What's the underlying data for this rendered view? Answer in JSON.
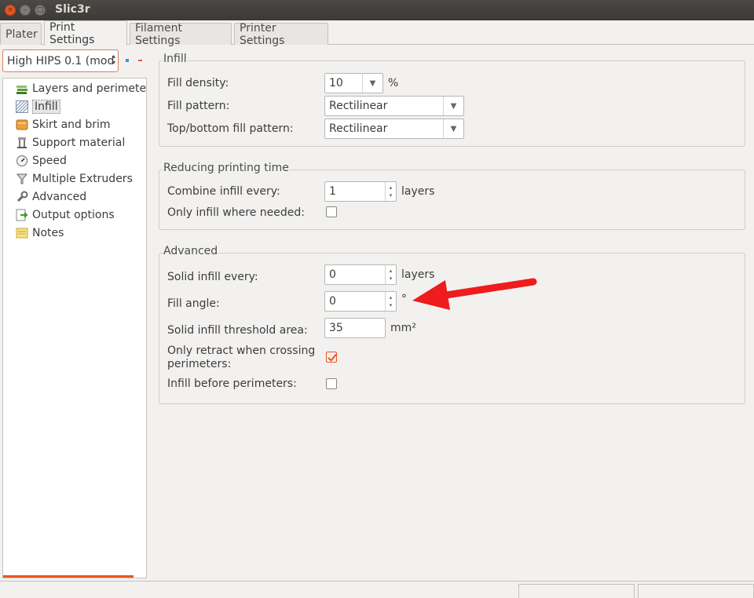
{
  "window": {
    "title": "Slic3r",
    "close_glyph": "×",
    "min_glyph": "–",
    "max_glyph": "□"
  },
  "tabs": [
    {
      "label": "Plater"
    },
    {
      "label": "Print Settings"
    },
    {
      "label": "Filament Settings"
    },
    {
      "label": "Printer Settings"
    }
  ],
  "preset": {
    "value": "High HIPS 0.1 (mod",
    "spin_up": "▴",
    "spin_down": "▾"
  },
  "tree": {
    "items": [
      {
        "label": "Layers and perimeters",
        "icon": "layers-icon"
      },
      {
        "label": "Infill",
        "icon": "infill-icon"
      },
      {
        "label": "Skirt and brim",
        "icon": "skirt-icon"
      },
      {
        "label": "Support material",
        "icon": "support-icon"
      },
      {
        "label": "Speed",
        "icon": "speed-icon"
      },
      {
        "label": "Multiple Extruders",
        "icon": "funnel-icon"
      },
      {
        "label": "Advanced",
        "icon": "wrench-icon"
      },
      {
        "label": "Output options",
        "icon": "output-icon"
      },
      {
        "label": "Notes",
        "icon": "notes-icon"
      }
    ]
  },
  "infill": {
    "title": "Infill",
    "fill_density_label": "Fill density:",
    "fill_density_value": "10",
    "fill_density_unit": "%",
    "fill_pattern_label": "Fill pattern:",
    "fill_pattern_value": "Rectilinear",
    "top_bottom_label": "Top/bottom fill pattern:",
    "top_bottom_value": "Rectilinear",
    "dropdown_glyph": "▼"
  },
  "reducing": {
    "title": "Reducing printing time",
    "combine_label": "Combine infill every:",
    "combine_value": "1",
    "combine_unit": "layers",
    "only_needed_label": "Only infill where needed:",
    "only_needed_checked": false
  },
  "advanced": {
    "title": "Advanced",
    "solid_every_label": "Solid infill every:",
    "solid_every_value": "0",
    "solid_every_unit": "layers",
    "fill_angle_label": "Fill angle:",
    "fill_angle_value": "0",
    "fill_angle_unit": "°",
    "threshold_label": "Solid infill threshold area:",
    "threshold_value": "35",
    "threshold_unit": "mm²",
    "retract_label_line1": "Only retract when crossing",
    "retract_label_line2": "perimeters:",
    "retract_checked": true,
    "before_perimeters_label": "Infill before perimeters:",
    "before_perimeters_checked": false
  },
  "spin": {
    "up": "▴",
    "down": "▾"
  },
  "colors": {
    "accent": "#e95420",
    "annotation_arrow": "#ee1c1c"
  }
}
